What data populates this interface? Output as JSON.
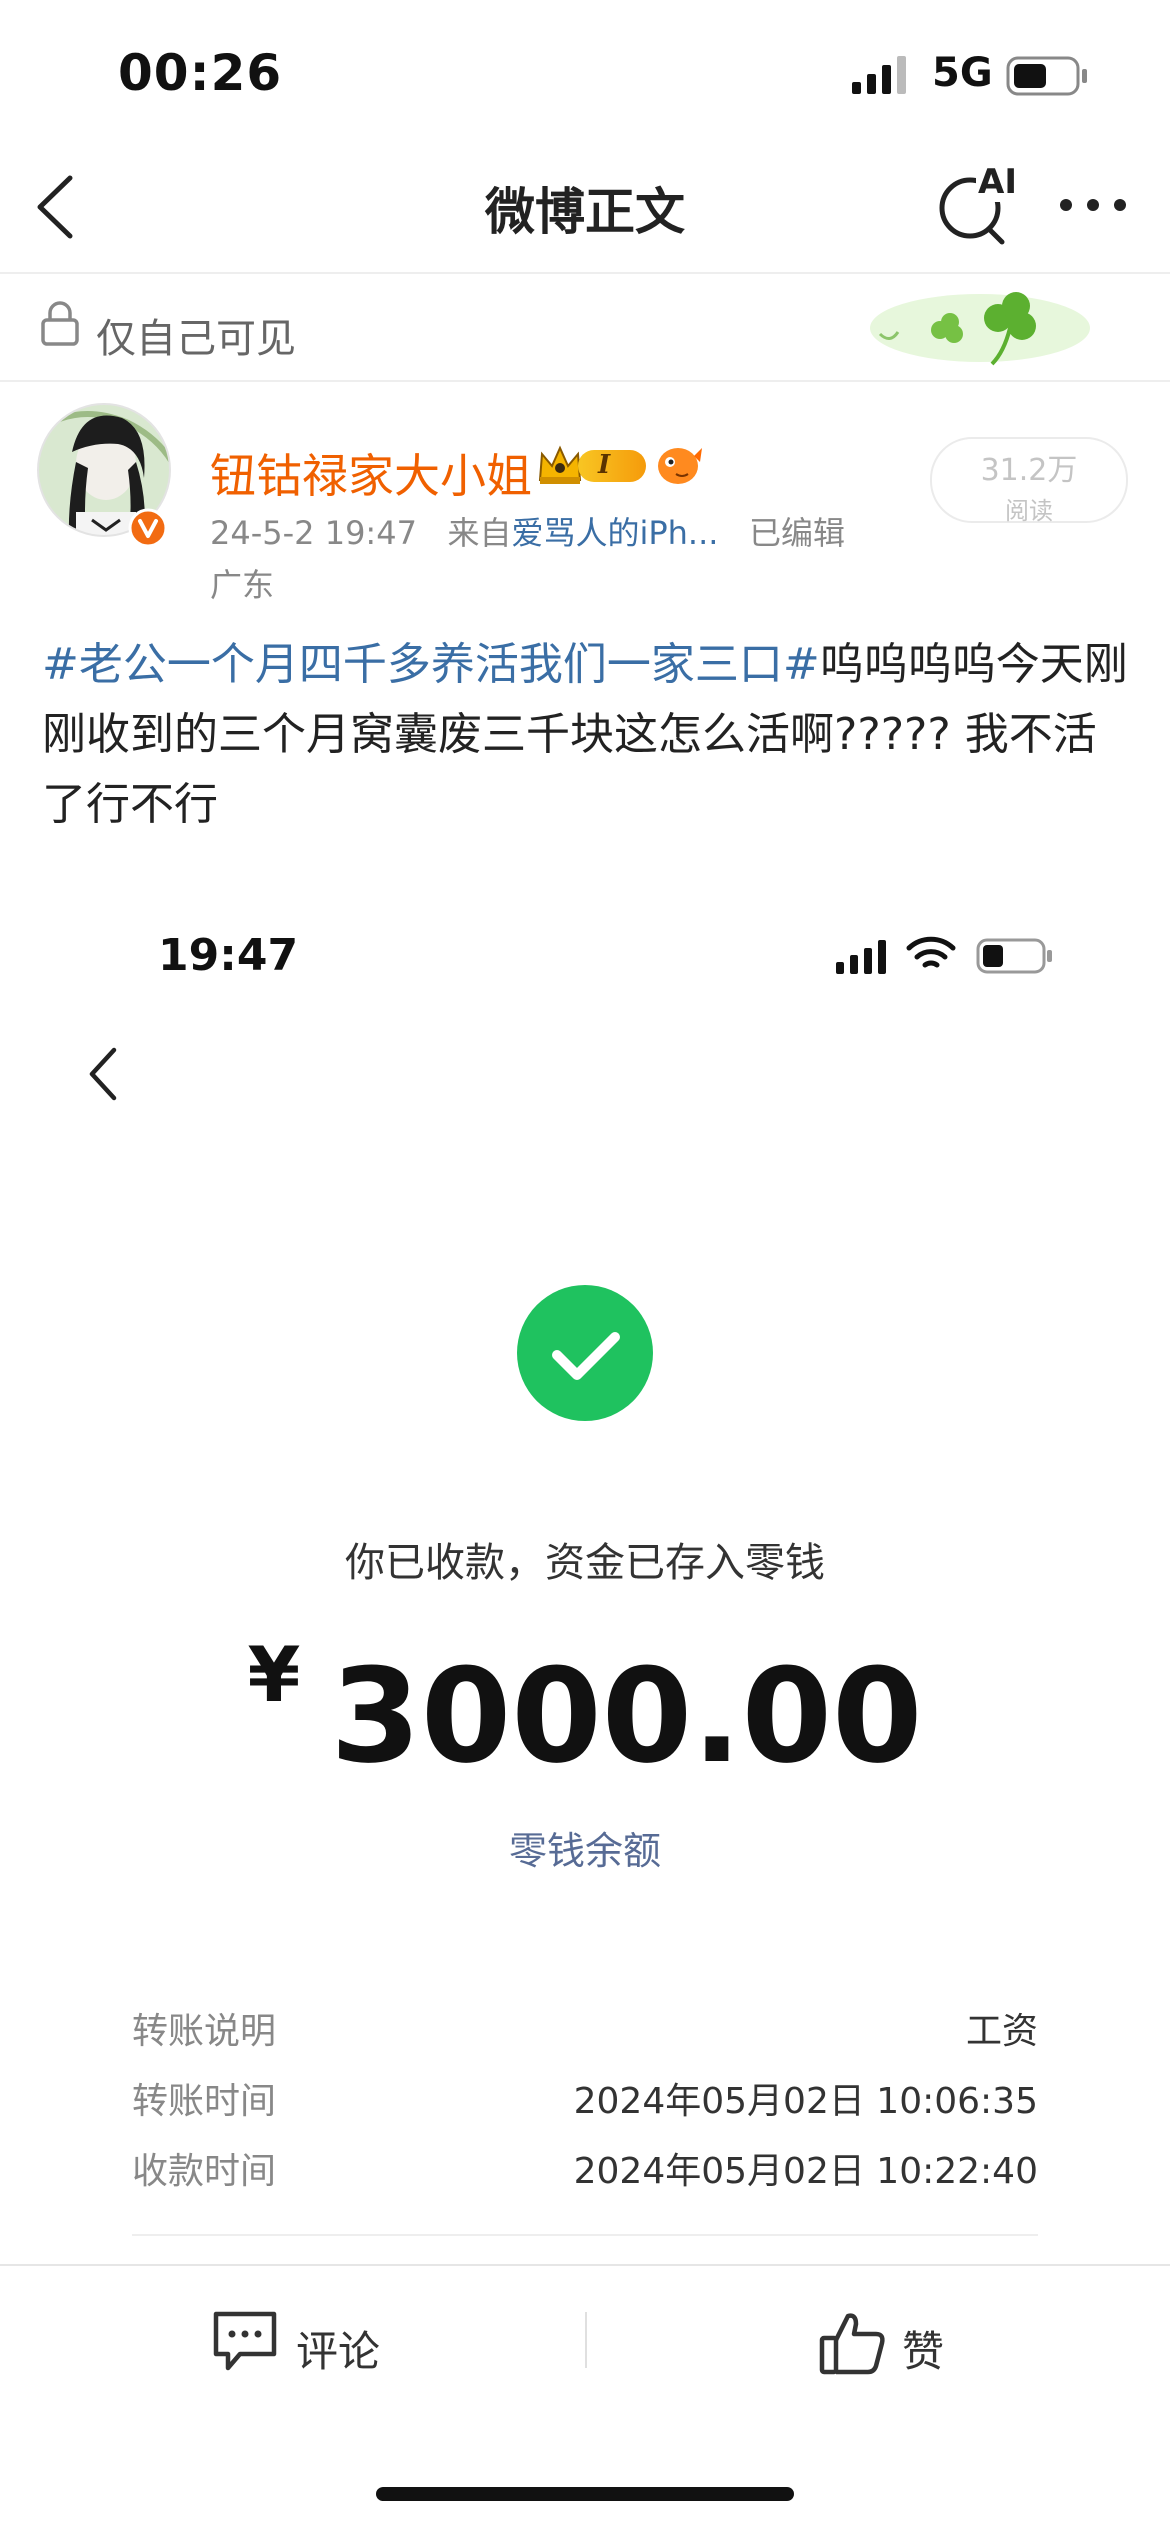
{
  "status_bar": {
    "time": "00:26",
    "network": "5G"
  },
  "nav": {
    "title": "微博正文",
    "ai_label": "AI"
  },
  "visibility": {
    "text": "仅自己可见"
  },
  "post": {
    "username": "钮钴禄家大小姐",
    "vip_badge": "I",
    "date": "24-5-2 19:47",
    "source_prefix": "来自",
    "source": "爱骂人的iPh...",
    "edited": "已编辑",
    "location": "广东",
    "read_count": "31.2万",
    "read_label": "阅读",
    "hashtag": "#老公一个月四千多养活我们一家三口#",
    "text": "呜呜呜呜今天刚刚收到的三个月窝囊废三千块这怎么活啊?????  我不活了行不行"
  },
  "embedded": {
    "time": "19:47",
    "received_text": "你已收款，资金已存入零钱",
    "currency": "¥",
    "amount": "3000.00",
    "balance_link": "零钱余额",
    "details": [
      {
        "label": "转账说明",
        "value": "工资"
      },
      {
        "label": "转账时间",
        "value": "2024年05月02日 10:06:35"
      },
      {
        "label": "收款时间",
        "value": "2024年05月02日 10:22:40"
      }
    ]
  },
  "bottom": {
    "comment": "评论",
    "like": "赞"
  },
  "colors": {
    "accent_link": "#3a6ea5",
    "username": "#f06000",
    "success": "#1fc25f"
  }
}
